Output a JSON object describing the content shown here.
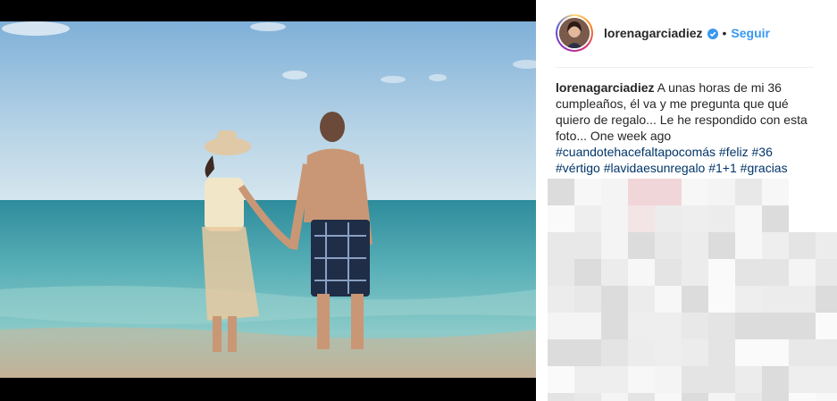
{
  "post": {
    "username": "lorenagarciadiez",
    "separator": "•",
    "follow_label": "Seguir",
    "caption_text": "A unas horas de mi 36 cumpleaños, él va y me pregunta que qué quiero de regalo... Le he respondido con esta foto... One week ago",
    "hashtags": [
      "#cuandotehacefaltapocomás",
      "#feliz",
      "#36",
      "#vértigo",
      "#lavidaesunregalo",
      "#1+1",
      "#gracias"
    ]
  },
  "icons": {
    "verified": "verified-badge-icon",
    "avatar": "profile-avatar"
  },
  "colors": {
    "link_blue": "#3897f0",
    "hashtag": "#003569",
    "text": "#262626"
  }
}
